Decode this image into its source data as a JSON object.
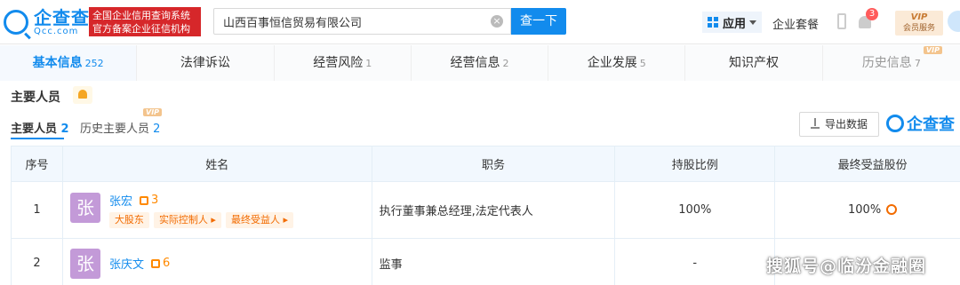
{
  "header": {
    "logo_cn": "企查查",
    "logo_en": "Qcc.com",
    "badge_line1": "全国企业信用查询系统",
    "badge_line2": "官方备案企业征信机构",
    "search_value": "山西百事恒信贸易有限公司",
    "search_button": "查一下",
    "app_menu": "应用",
    "package_link": "企业套餐",
    "notification_count": "3",
    "vip_label": "VIP",
    "vip_sub": "会员服务"
  },
  "tabs": [
    {
      "label": "基本信息",
      "count": "252"
    },
    {
      "label": "法律诉讼",
      "count": ""
    },
    {
      "label": "经营风险",
      "count": "1"
    },
    {
      "label": "经营信息",
      "count": "2"
    },
    {
      "label": "企业发展",
      "count": "5"
    },
    {
      "label": "知识产权",
      "count": ""
    },
    {
      "label": "历史信息",
      "count": "7",
      "vip": "VIP"
    }
  ],
  "section": {
    "title": "主要人员",
    "subtab_main": "主要人员",
    "subtab_main_count": "2",
    "subtab_history": "历史主要人员",
    "subtab_history_count": "2",
    "vip": "VIP",
    "export": "导出数据",
    "brand": "企查查"
  },
  "table": {
    "headers": [
      "序号",
      "姓名",
      "职务",
      "持股比例",
      "最终受益股份"
    ],
    "rows": [
      {
        "idx": "1",
        "avatar": "张",
        "name": "张宏",
        "relations": "3",
        "tags": [
          "大股东",
          "实际控制人 ▸",
          "最终受益人 ▸"
        ],
        "position": "执行董事兼总经理,法定代表人",
        "share": "100%",
        "final": "100%"
      },
      {
        "idx": "2",
        "avatar": "张",
        "name": "张庆文",
        "relations": "6",
        "position": "监事",
        "share": "-",
        "final": ""
      }
    ]
  },
  "watermark": "搜狐号@临汾金融圈",
  "colors": {
    "accent": "#128bed",
    "brand_red": "#d6272a",
    "tag_orange": "#f26b00"
  }
}
